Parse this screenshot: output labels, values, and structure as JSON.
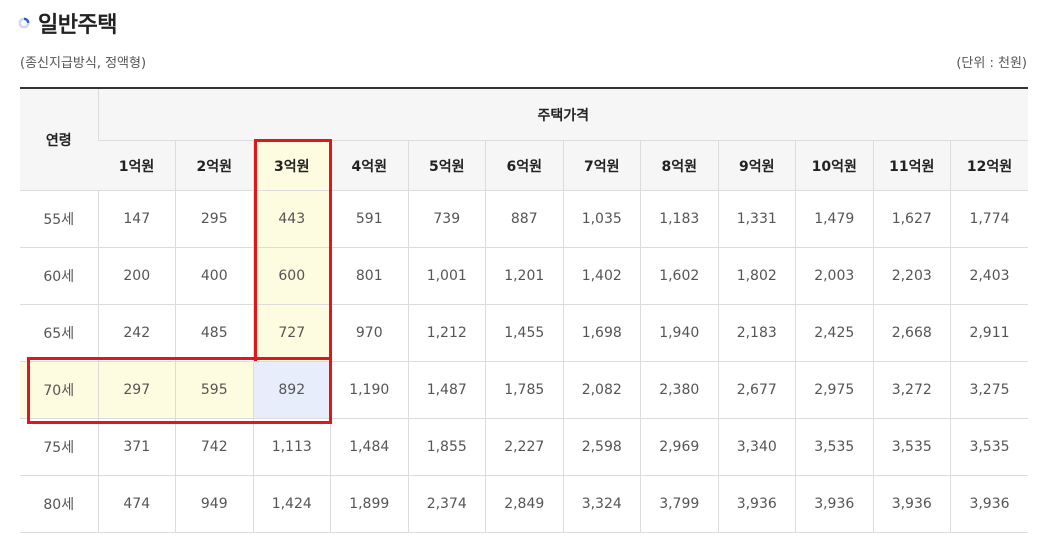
{
  "title": "일반주택",
  "subtitle": "(종신지급방식, 정액형)",
  "unit": "(단위 : 천원)",
  "table": {
    "age_header": "연령",
    "price_header": "주택가격",
    "columns": [
      "1억원",
      "2억원",
      "3억원",
      "4억원",
      "5억원",
      "6억원",
      "7억원",
      "8억원",
      "9억원",
      "10억원",
      "11억원",
      "12억원"
    ],
    "rows": [
      {
        "age": "55세",
        "values": [
          "147",
          "295",
          "443",
          "591",
          "739",
          "887",
          "1,035",
          "1,183",
          "1,331",
          "1,479",
          "1,627",
          "1,774"
        ]
      },
      {
        "age": "60세",
        "values": [
          "200",
          "400",
          "600",
          "801",
          "1,001",
          "1,201",
          "1,402",
          "1,602",
          "1,802",
          "2,003",
          "2,203",
          "2,403"
        ]
      },
      {
        "age": "65세",
        "values": [
          "242",
          "485",
          "727",
          "970",
          "1,212",
          "1,455",
          "1,698",
          "1,940",
          "2,183",
          "2,425",
          "2,668",
          "2,911"
        ]
      },
      {
        "age": "70세",
        "values": [
          "297",
          "595",
          "892",
          "1,190",
          "1,487",
          "1,785",
          "2,082",
          "2,380",
          "2,677",
          "2,975",
          "3,272",
          "3,275"
        ]
      },
      {
        "age": "75세",
        "values": [
          "371",
          "742",
          "1,113",
          "1,484",
          "1,855",
          "2,227",
          "2,598",
          "2,969",
          "3,340",
          "3,535",
          "3,535",
          "3,535"
        ]
      },
      {
        "age": "80세",
        "values": [
          "474",
          "949",
          "1,424",
          "1,899",
          "2,374",
          "2,849",
          "3,324",
          "3,799",
          "3,936",
          "3,936",
          "3,936",
          "3,936"
        ]
      }
    ],
    "highlight": {
      "column_index": 2,
      "row_index": 3
    }
  },
  "colors": {
    "highlight_fill": "#fdfbe0",
    "intersection_fill": "#e7edfa",
    "box_border": "#e0161b"
  },
  "icons": {
    "title_icon": "blue-circle-bullet-icon"
  }
}
